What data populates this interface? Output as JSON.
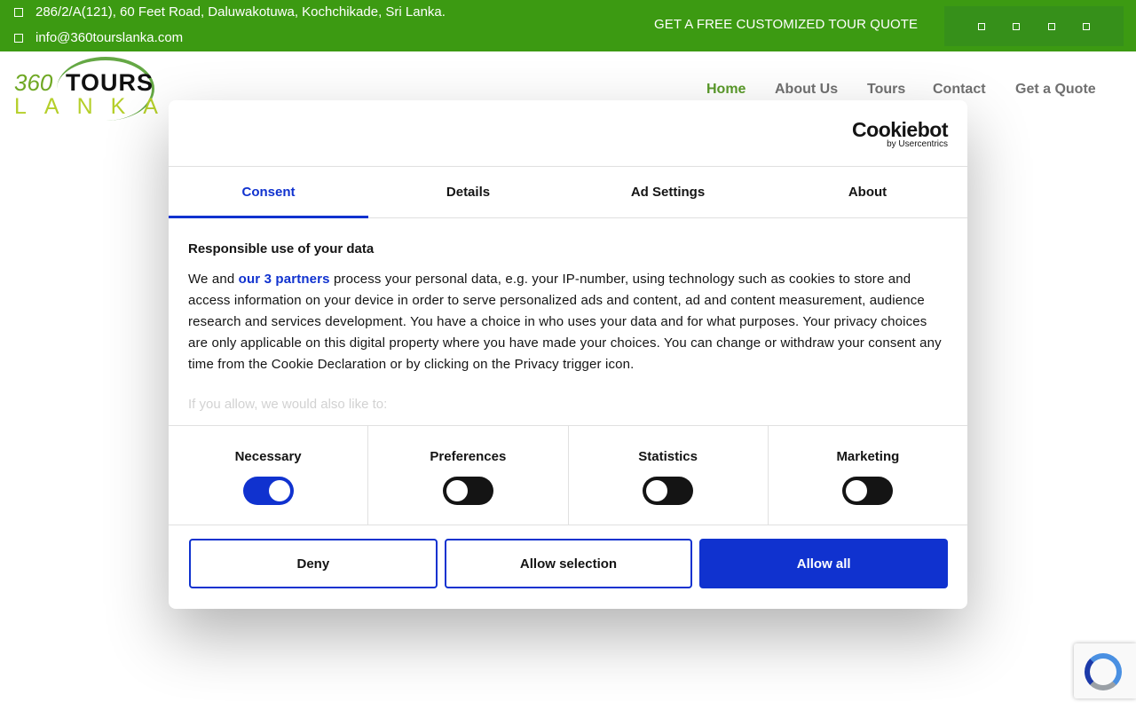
{
  "topbar": {
    "address": "286/2/A(121), 60 Feet Road, Daluwakotuwa, Kochchikade, Sri Lanka.",
    "email": "info@360tourslanka.com",
    "quote_link": "GET A FREE CUSTOMIZED TOUR QUOTE",
    "social_icons": [
      "social-icon-1",
      "social-icon-2",
      "social-icon-3",
      "social-icon-4"
    ]
  },
  "logo": {
    "part1": "360",
    "part2": "TOURS",
    "part3": "LANKA"
  },
  "nav": {
    "items": [
      {
        "label": "Home",
        "active": true
      },
      {
        "label": "About Us",
        "active": false
      },
      {
        "label": "Tours",
        "active": false
      },
      {
        "label": "Contact",
        "active": false
      },
      {
        "label": " Get a Quote",
        "active": false
      }
    ]
  },
  "dialog": {
    "brand": "Cookiebot",
    "brand_sub": "by Usercentrics",
    "tabs": [
      {
        "label": "Consent",
        "active": true
      },
      {
        "label": "Details",
        "active": false
      },
      {
        "label": "Ad Settings",
        "active": false
      },
      {
        "label": "About",
        "active": false
      }
    ],
    "heading": "Responsible use of your data",
    "body_before_link": "We and ",
    "body_link": "our 3 partners",
    "body_after_link": " process your personal data, e.g. your IP-number, using technology such as cookies to store and access information on your device in order to serve personalized ads and content, ad and content measurement, audience research and services development. You have a choice in who uses your data and for what purposes. Your privacy choices are only applicable on this digital property where you have made your choices. You can change or withdraw your consent any time from the Cookie Declaration or by clicking on the Privacy trigger icon.",
    "faded_line": "If you allow, we would also like to:",
    "toggles": [
      {
        "label": "Necessary",
        "on": true
      },
      {
        "label": "Preferences",
        "on": false
      },
      {
        "label": "Statistics",
        "on": false
      },
      {
        "label": "Marketing",
        "on": false
      }
    ],
    "buttons": {
      "deny": "Deny",
      "allow_selection": "Allow selection",
      "allow_all": "Allow all"
    }
  },
  "colors": {
    "topbar_green": "#3c9a12",
    "cookiebot_blue": "#1032cf",
    "nav_active": "#5a9a2a"
  }
}
